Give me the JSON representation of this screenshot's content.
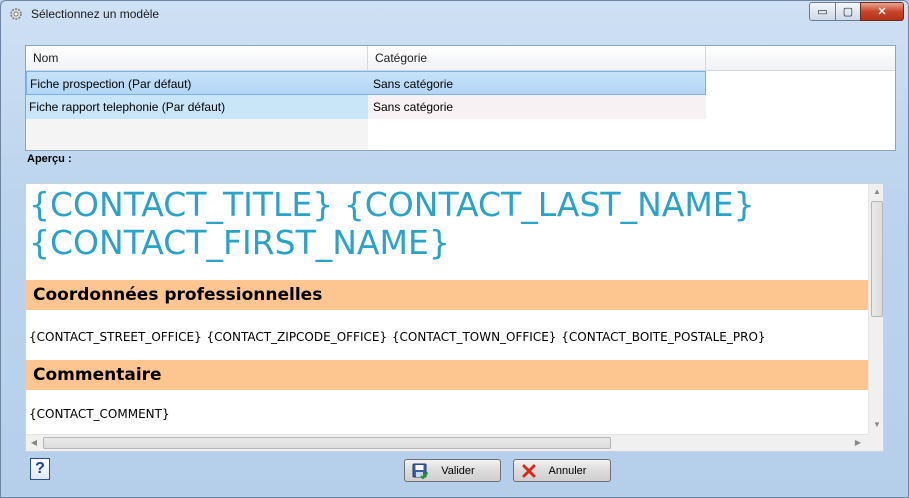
{
  "window": {
    "title": "Sélectionnez un modèle",
    "controls": {
      "minimize": "▭",
      "maximize": "▢",
      "close": "✕"
    }
  },
  "grid": {
    "columns": [
      "Nom",
      "Catégorie"
    ],
    "rows": [
      {
        "nom": "Fiche prospection (Par défaut)",
        "categorie": "Sans catégorie",
        "selected": true
      },
      {
        "nom": "Fiche rapport telephonie (Par défaut)",
        "categorie": "Sans catégorie",
        "selected": false
      }
    ]
  },
  "preview": {
    "label": "Aperçu :",
    "title_line1": "{CONTACT_TITLE} {CONTACT_LAST_NAME}",
    "title_line2": "{CONTACT_FIRST_NAME}",
    "section1": "Coordonnées professionnelles",
    "section1_line": "{CONTACT_STREET_OFFICE} {CONTACT_ZIPCODE_OFFICE} {CONTACT_TOWN_OFFICE}  {CONTACT_BOITE_POSTALE_PRO}",
    "section2": "Commentaire",
    "section2_line": "{CONTACT_COMMENT}",
    "section_color": "#fdc590",
    "title_color": "#29a3c7"
  },
  "footer": {
    "help": "?",
    "valider": "Valider",
    "annuler": "Annuler"
  }
}
